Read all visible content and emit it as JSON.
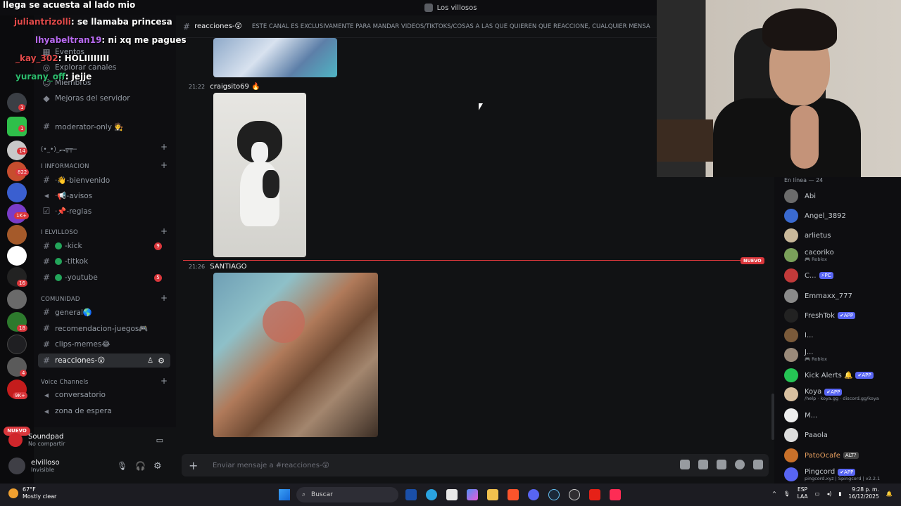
{
  "window": {
    "title": "Los villosos"
  },
  "overlay": {
    "top_line": "llega se acuesta al lado mio",
    "messages": [
      {
        "user": "juliantrizolli",
        "text": ": se llamaba princesa"
      },
      {
        "user": "lhyabeltran19",
        "text": ": ni xq me pagues"
      },
      {
        "user": "_kay_302",
        "text": ": HOLIIIIIIII"
      },
      {
        "user": "yurany_off",
        "text": ": jejje"
      }
    ]
  },
  "sidebar": {
    "server_name": "Los villosos",
    "menu": [
      "Eventos",
      "Explorar canales",
      "Miembros",
      "Mejoras del servidor"
    ],
    "channels": [
      {
        "name": "moderator-only 🧑‍⚖️",
        "type": "text"
      },
      {
        "name": "(•_•)_︻╦╤─",
        "type": "category"
      },
      {
        "name": "I INFORMACION",
        "type": "category"
      },
      {
        "name": "·👋-bienvenido",
        "type": "text"
      },
      {
        "name": "·📢-avisos",
        "type": "announce"
      },
      {
        "name": "·📌-reglas",
        "type": "rules"
      },
      {
        "name": "I elvilloso",
        "type": "category"
      },
      {
        "name": "-kick",
        "type": "text",
        "count": "9"
      },
      {
        "name": "-titkok",
        "type": "text"
      },
      {
        "name": "-youtube",
        "type": "text",
        "count": "5"
      },
      {
        "name": "COMUNIDAD",
        "type": "category"
      },
      {
        "name": "general🌎",
        "type": "text"
      },
      {
        "name": "recomendacion-juegos🎮",
        "type": "text"
      },
      {
        "name": "clips-memes😂",
        "type": "text"
      },
      {
        "name": "reacciones-😲",
        "type": "text",
        "active": true
      },
      {
        "name": "Voice Channels",
        "type": "category"
      },
      {
        "name": "conversatorio",
        "type": "voice"
      },
      {
        "name": "zona de espera",
        "type": "voice"
      }
    ],
    "nuevo_pill": "NUEVO",
    "soundpad": {
      "name": "Soundpad",
      "status": "No compartir"
    },
    "user": {
      "name": "elvilloso",
      "status": "Invisible"
    },
    "rail_badges": [
      "1",
      "1",
      "14",
      "822",
      "1",
      "1K+",
      "1",
      "16",
      "18",
      "4",
      "9K+"
    ]
  },
  "chat": {
    "channel": "reacciones-😲",
    "topic": "ESTE CANAL ES EXCLUSIVAMENTE PARA MANDAR VIDEOS/TIKTOKS/COSAS A LAS QUE QUIEREN QUE REACCIONE, CUALQUIER MENSA",
    "messages": [
      {
        "time": "21:22",
        "author": "craigsito69 🔥"
      },
      {
        "time": "21:26",
        "author": "SANTIAGO"
      }
    ],
    "new_divider": "NUEVO",
    "composer_placeholder": "Enviar mensaje a #reacciones-😲"
  },
  "members": {
    "header": "En línea — 24",
    "list": [
      {
        "name": "Abi",
        "sub": ""
      },
      {
        "name": "Angel_3892",
        "sub": ""
      },
      {
        "name": "arlietus",
        "sub": ""
      },
      {
        "name": "cacoriko",
        "sub": "🎮 Roblox"
      },
      {
        "name": "C...",
        "sub": "",
        "tag": "⚡PC"
      },
      {
        "name": "Emmaxx_777",
        "sub": ""
      },
      {
        "name": "FreshTok",
        "sub": "",
        "tag": "✔APP"
      },
      {
        "name": "I...",
        "sub": ""
      },
      {
        "name": "J...",
        "sub": "🎮 Roblox"
      },
      {
        "name": "Kick Alerts 🔔",
        "sub": "",
        "tag": "✔APP"
      },
      {
        "name": "Koya",
        "sub": "/help · koya.gg · discord.gg/koya",
        "tag": "✔APP"
      },
      {
        "name": "M...",
        "sub": ""
      },
      {
        "name": "Paaola",
        "sub": ""
      },
      {
        "name": "PatoOcafe",
        "sub": "",
        "tag": "ALT?"
      },
      {
        "name": "Pingcord",
        "sub": "pingcord.xyz | Spingcord | v2.2.1",
        "tag": "✔APP"
      }
    ]
  },
  "taskbar": {
    "temp": "67°F",
    "weather": "Mostly clear",
    "search": "Buscar",
    "lang1": "ESP",
    "lang2": "LAA",
    "time": "9:28 p. m.",
    "date": "16/12/2025"
  },
  "colors": {
    "accent": "#5865f2",
    "danger": "#da373c",
    "online": "#23a55a"
  }
}
